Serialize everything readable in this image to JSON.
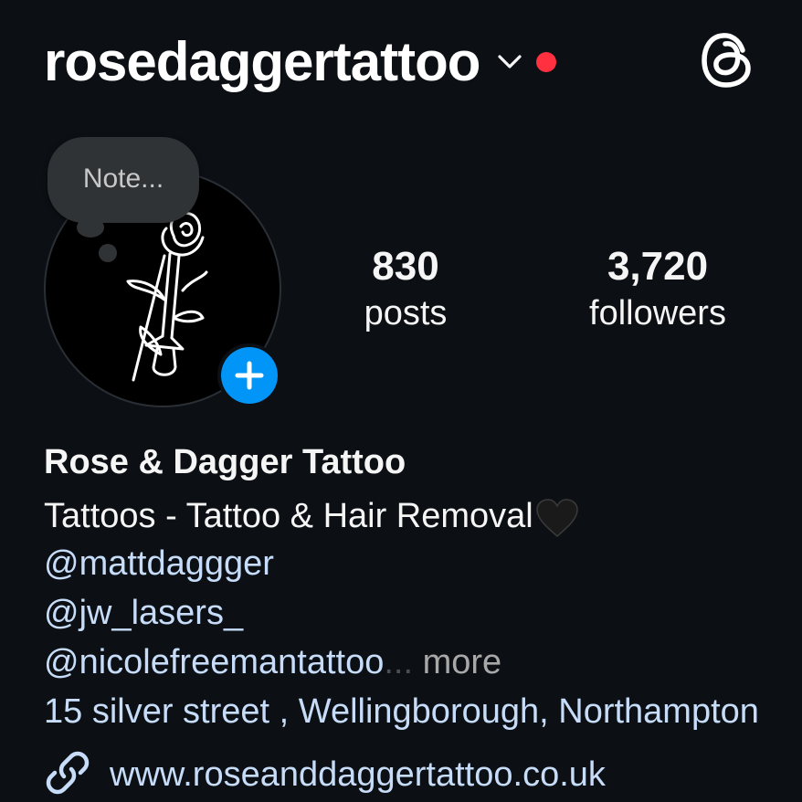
{
  "header": {
    "username": "rosedaggertattoo",
    "icons": [
      "chevron-down-icon",
      "notification-dot",
      "threads-icon"
    ],
    "accent_dot_color": "#ff3040"
  },
  "profile": {
    "note_placeholder": "Note...",
    "add_story_icon": "plus-icon",
    "stats": [
      {
        "value": "830",
        "label": "posts"
      },
      {
        "value": "3,720",
        "label": "followers"
      }
    ]
  },
  "bio": {
    "display_name": "Rose & Dagger Tattoo",
    "category_line": "Tattoos - Tattoo & Hair Removal",
    "mentions": [
      "@mattdaggger",
      "@jw_lasers_",
      "@nicolefreemantattoo"
    ],
    "ellipsis": "...",
    "more_label": "more",
    "address": "15 silver street , Wellingborough, Northampton",
    "website": "www.roseanddaggertattoo.co.uk"
  },
  "colors": {
    "background": "#0c1014",
    "link_blue": "#c6dcf8",
    "primary_blue": "#0095f6"
  }
}
